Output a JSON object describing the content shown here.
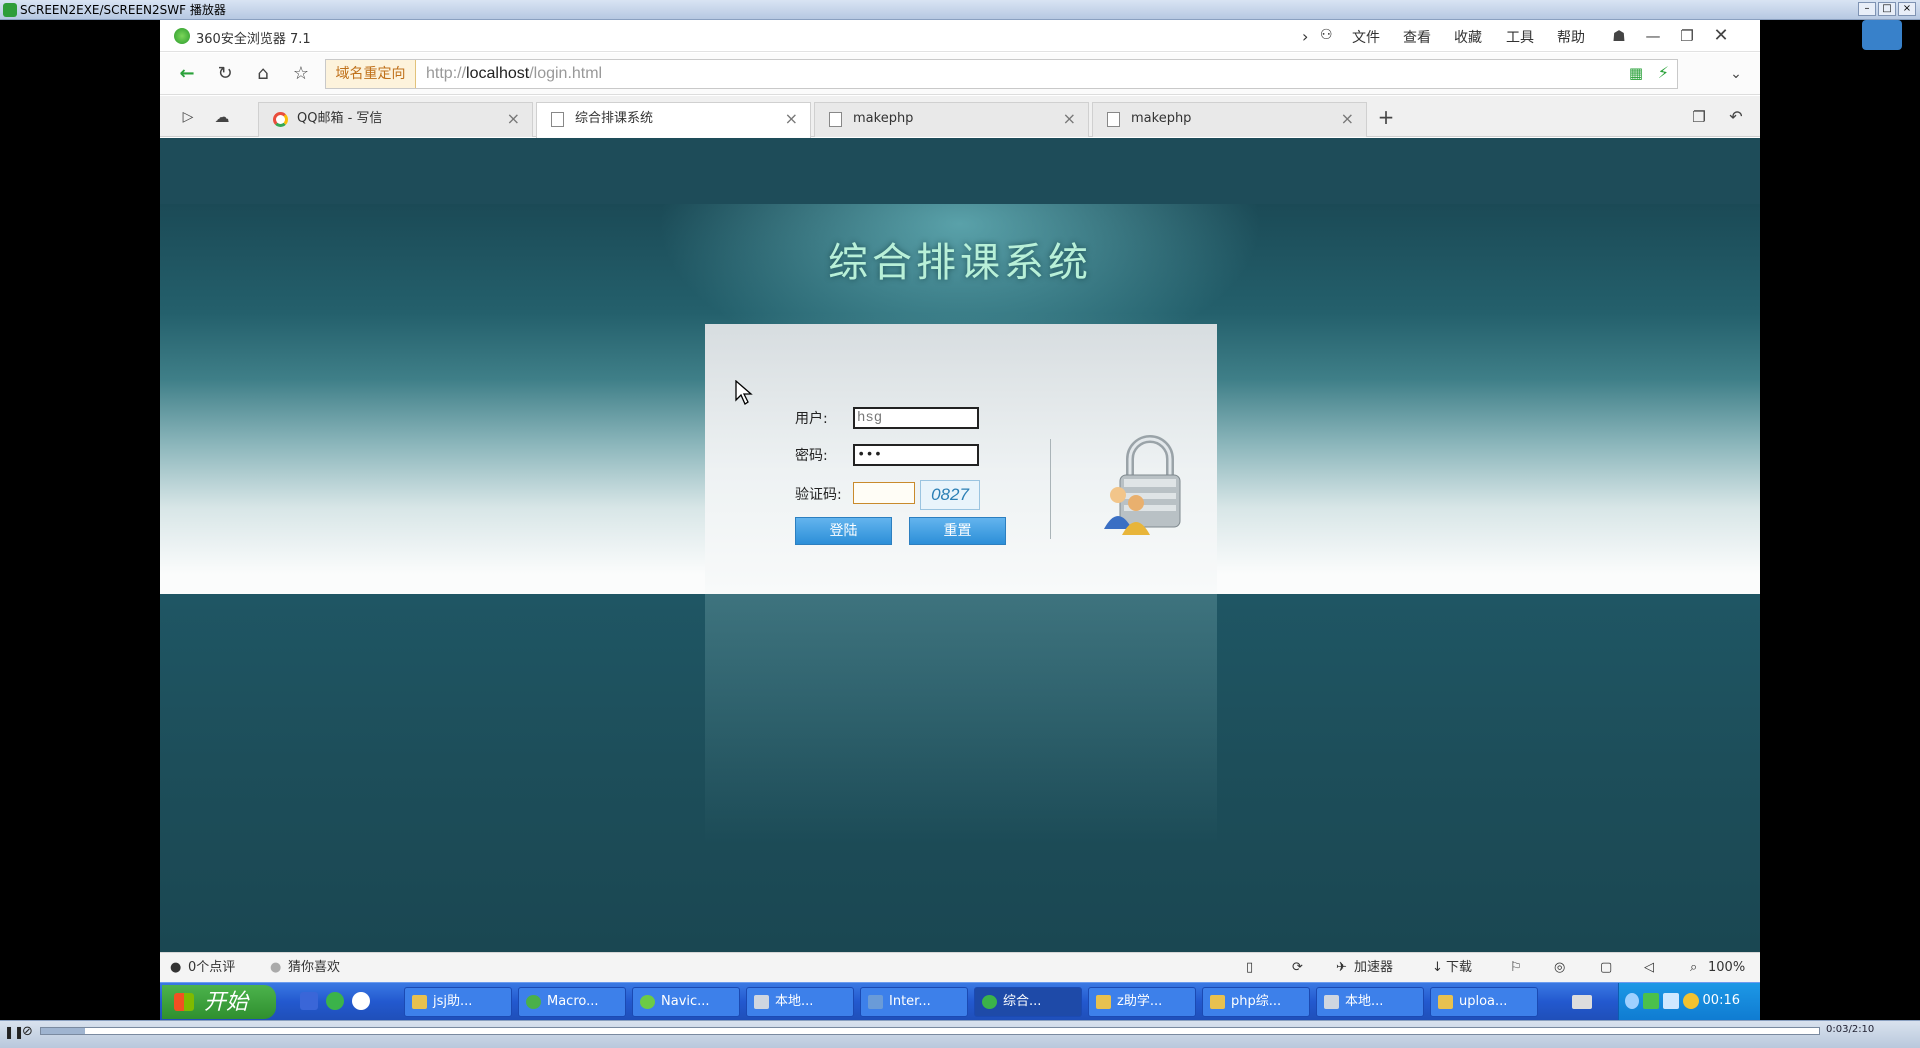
{
  "player": {
    "title": "SCREEN2EXE/SCREEN2SWF 播放器",
    "time": "0:03/2:10",
    "progress": 0.025
  },
  "browser": {
    "name": "360安全浏览器 7.1",
    "menu": [
      "文件",
      "查看",
      "收藏",
      "工具",
      "帮助"
    ],
    "redirect_label": "域名重定向",
    "url_prefix": "http://",
    "url_host": "localhost",
    "url_path": "/login.html",
    "tabs": [
      {
        "label": "QQ邮箱 - 写信",
        "active": false
      },
      {
        "label": "综合排课系统",
        "active": true
      },
      {
        "label": "makephp",
        "active": false
      },
      {
        "label": "makephp",
        "active": false
      }
    ]
  },
  "page": {
    "site_title": "综合排课系统",
    "user_label": "用户:",
    "user_value": "hsg",
    "password_label": "密码:",
    "password_value": "•••",
    "captcha_label": "验证码:",
    "captcha_code": "0827",
    "login_button": "登陆",
    "reset_button": "重置"
  },
  "statusbar": {
    "reviews": "0个点评",
    "guess": "猜你喜欢",
    "accelerator": "加速器",
    "download": "下载",
    "zoom": "100%"
  },
  "taskbar": {
    "start_label": "开始",
    "tasks": [
      "jsj助...",
      "Macro...",
      "Navic...",
      "本地...",
      "Inter...",
      "综合...",
      "z助学...",
      "php综...",
      "本地...",
      "uploa..."
    ],
    "clock": "00:16"
  },
  "colors": {
    "title_green": "#b8f0d8",
    "button_blue": "#2c8fd8",
    "taskbar_blue": "#2359cf"
  }
}
